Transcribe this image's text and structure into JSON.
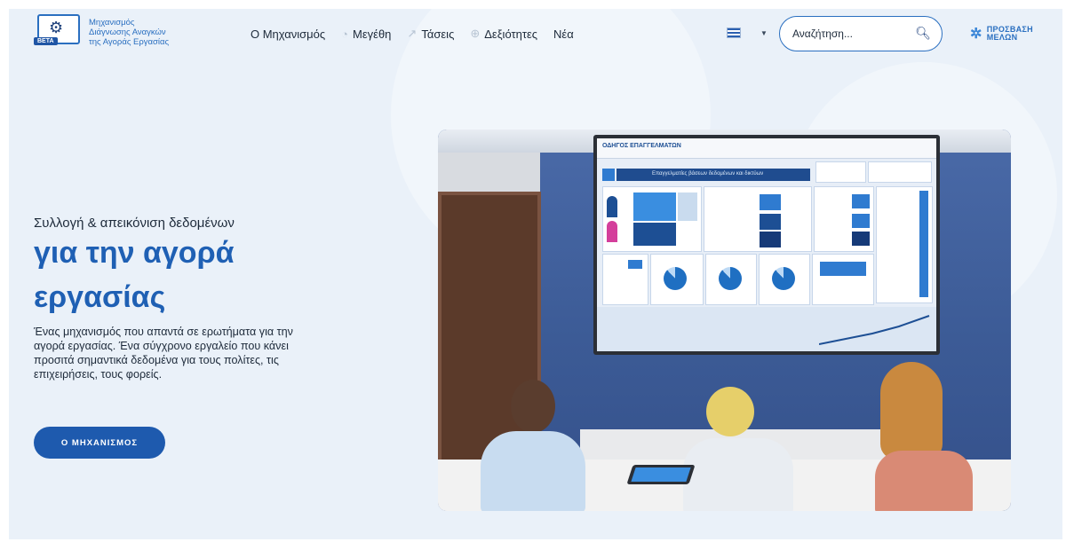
{
  "brand": {
    "logo_lines": [
      "Μηχανισμός",
      "Διάγνωσης Αναγκών",
      "της Αγοράς Εργασίας"
    ],
    "beta_label": "BETA"
  },
  "nav": {
    "items": [
      {
        "label": "Ο Μηχανισμός",
        "icon": ""
      },
      {
        "label": "Μεγέθη",
        "icon": "pie-chart-icon"
      },
      {
        "label": "Τάσεις",
        "icon": "trend-line-icon"
      },
      {
        "label": "Δεξιότητες",
        "icon": "skills-globe-icon"
      },
      {
        "label": "Νέα",
        "icon": ""
      }
    ]
  },
  "lang": {
    "selected": "greek-flag-icon"
  },
  "search": {
    "placeholder": "Αναζήτηση..."
  },
  "members": {
    "line1": "ΠΡΟΣΒΑΣΗ",
    "line2": "ΜΕΛΩΝ"
  },
  "hero": {
    "subtitle": "Συλλογή & απεικόνιση δεδομένων",
    "title_line1": "για την αγορά",
    "title_line2": "εργασίας",
    "description": "Ένας μηχανισμός που απαντά σε ερωτήματα για την αγορά εργασίας. Ένα σύγχρονο εργαλείο που κάνει προσιτά σημαντικά δεδομένα για τους πολίτες, τις επιχειρήσεις, τους φορείς.",
    "cta_label": "Ο ΜΗΧΑΝΙΣΜΟΣ"
  },
  "photo": {
    "screen_title": "ΟΔΗΓΟΣ ΕΠΑΓΓΕΛΜΑΤΩΝ",
    "screen_band": "Επαγγελματίες βάσεων δεδομένων και δικτύων"
  },
  "colors": {
    "accent": "#1f60b4",
    "background": "#eaf1f9",
    "cta": "#1e5aae"
  }
}
